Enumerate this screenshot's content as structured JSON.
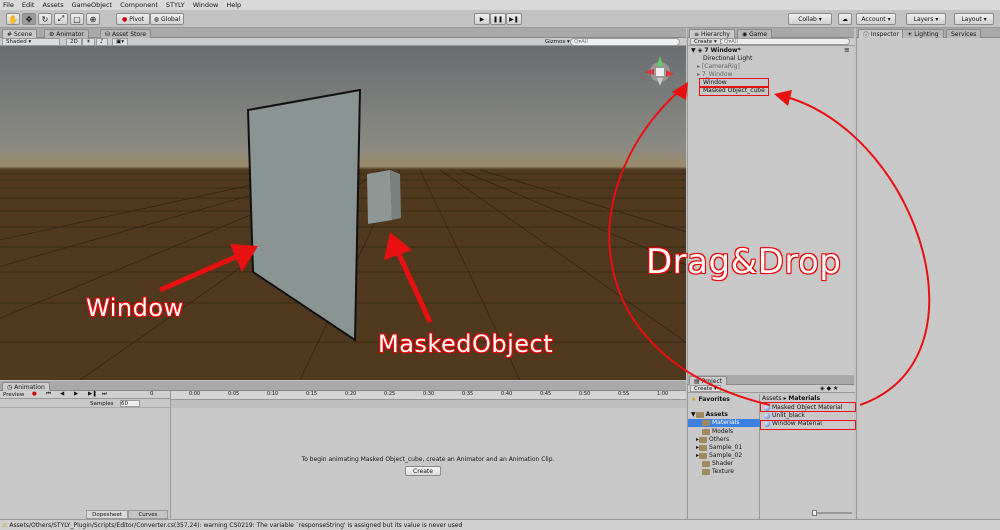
{
  "menu": [
    "File",
    "Edit",
    "Assets",
    "GameObject",
    "Component",
    "STYLY",
    "Window",
    "Help"
  ],
  "toolbar": {
    "pivot": "Pivot",
    "global": "Global",
    "collab": "Collab",
    "account": "Account",
    "layers": "Layers",
    "layout": "Layout"
  },
  "scene": {
    "tabs": [
      "Scene",
      "Animator",
      "Asset Store"
    ],
    "shading": "Shaded",
    "mode_2d": "2D",
    "gizmos": "Gizmos",
    "search_placeholder": "Q▾All"
  },
  "hierarchy": {
    "tab": "Hierarchy",
    "game_tab": "Game",
    "create": "Create",
    "search": "Q▾All",
    "root": "7 Window*",
    "items": [
      "Directional Light",
      "[CameraRig]",
      "7_Window",
      "Window",
      "Masked Object_cube"
    ]
  },
  "inspector": {
    "tabs": [
      "Inspector",
      "Lighting",
      "Services"
    ]
  },
  "project": {
    "tab": "Project",
    "create": "Create",
    "favorites": "Favorites",
    "breadcrumb": [
      "Assets",
      "Materials"
    ],
    "tree": [
      "Assets",
      "Materials",
      "Models",
      "Others",
      "Sample_01",
      "Sample_02",
      "Shader",
      "Texture"
    ],
    "materials": [
      "Masked Object Material",
      "Unlit_black",
      "Window Material"
    ]
  },
  "animation": {
    "tab": "Animation",
    "preview": "Preview",
    "samples_label": "Samples",
    "samples_value": "60",
    "ruler": [
      "0:00",
      "0:05",
      "0:10",
      "0:15",
      "0:20",
      "0:25",
      "0:30",
      "0:35",
      "0:40",
      "0:45",
      "0:50",
      "0:55",
      "1:00"
    ],
    "dopesheet": "Dopesheet",
    "curves": "Curves",
    "message": "To begin animating Masked Object_cube, create an Animator and an Animation Clip.",
    "create_button": "Create"
  },
  "status_bar": "Assets/Others/STYLY_Plugin/Scripts/Editor/Converter.cs(357,24): warning CS0219: The variable `responseString' is assigned but its value is never used",
  "annotations": {
    "window_label": "Window",
    "masked_label": "MaskedObject",
    "drag_label": "Drag&Drop",
    "color": "#e81010"
  }
}
